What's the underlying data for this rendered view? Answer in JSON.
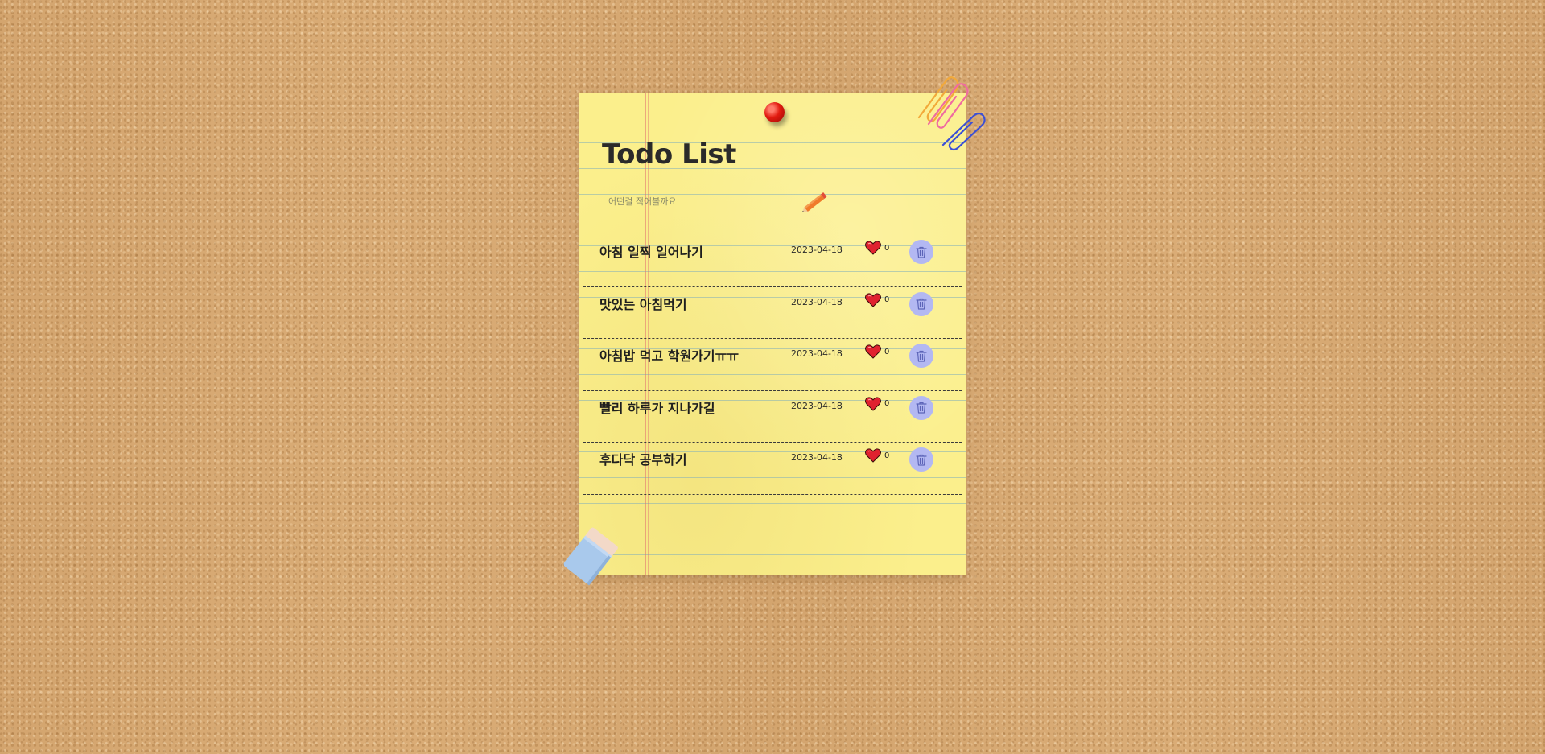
{
  "app": {
    "title": "Todo List"
  },
  "input": {
    "placeholder": "어떤걸 적어볼까요",
    "value": ""
  },
  "todos": [
    {
      "text": "아침 일찍 일어나기",
      "date": "2023-04-18",
      "likes": "0"
    },
    {
      "text": "맛있는 아침먹기",
      "date": "2023-04-18",
      "likes": "0"
    },
    {
      "text": "아침밥 먹고 학원가기ㅠㅠ",
      "date": "2023-04-18",
      "likes": "0"
    },
    {
      "text": "빨리 하루가 지나가길",
      "date": "2023-04-18",
      "likes": "0"
    },
    {
      "text": "후다닥 공부하기",
      "date": "2023-04-18",
      "likes": "0"
    }
  ],
  "icons": {
    "add": "pencil-icon",
    "like": "heart-icon",
    "delete": "trash-icon",
    "pin": "pushpin-icon",
    "clips": "paperclip-icon",
    "eraser": "eraser-icon"
  },
  "colors": {
    "paper": "#fbef8c",
    "board": "#d8aa74",
    "input_underline": "#3a4bd6",
    "delete_button": "#b3b8f2",
    "heart": "#e0222f",
    "pin": "#e21b10"
  }
}
